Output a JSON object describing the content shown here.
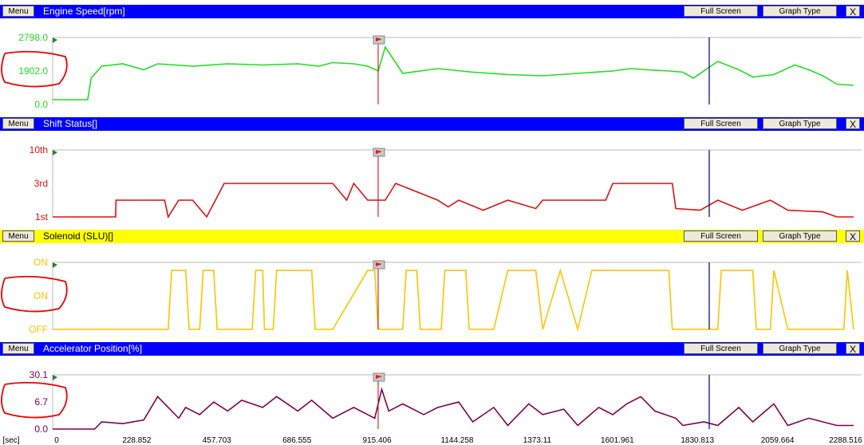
{
  "colors": {
    "header_blue": "#0000ff",
    "header_yellow": "#ffff00",
    "engine": "#22dd22",
    "shift": "#dd1111",
    "solenoid": "#ffc400",
    "accel": "#800050",
    "annotation": "#ee0000"
  },
  "ui": {
    "menu_label": "Menu",
    "full_screen_label": "Full Screen",
    "graph_type_label": "Graph Type",
    "close_label": "X"
  },
  "x_axis": {
    "unit_label": "[sec]",
    "ticks": [
      "0",
      "228.852",
      "457.703",
      "686.555",
      "915.406",
      "1144.258",
      "1373.11",
      "1601.961",
      "1830.813",
      "2059.664",
      "2288.516"
    ]
  },
  "chart_data": [
    {
      "type": "line",
      "title": "Engine Speed[rpm]",
      "ylim": [
        0,
        2798
      ],
      "y_ticks": [
        "2798.0",
        "1902.0",
        "0.0"
      ],
      "circled_tick": "1902.0",
      "x": [
        0,
        100,
        110,
        140,
        200,
        260,
        300,
        400,
        500,
        600,
        700,
        760,
        800,
        860,
        900,
        930,
        950,
        1000,
        1100,
        1200,
        1300,
        1400,
        1500,
        1600,
        1650,
        1700,
        1760,
        1800,
        1830,
        1900,
        1960,
        2000,
        2060,
        2120,
        2160,
        2200,
        2240,
        2288
      ],
      "values": [
        200,
        200,
        1100,
        1600,
        1700,
        1450,
        1700,
        1600,
        1700,
        1650,
        1700,
        1600,
        1750,
        1700,
        1600,
        1400,
        2400,
        1300,
        1500,
        1350,
        1250,
        1200,
        1300,
        1400,
        1500,
        1450,
        1400,
        1350,
        1100,
        1800,
        1450,
        1150,
        1250,
        1650,
        1450,
        1200,
        850,
        800
      ]
    },
    {
      "type": "line",
      "title": "Shift Status[]",
      "y_ticks": [
        "10th",
        "3rd",
        "1st"
      ],
      "x": [
        0,
        180,
        181,
        320,
        330,
        360,
        400,
        440,
        490,
        540,
        800,
        840,
        860,
        900,
        950,
        980,
        1100,
        1130,
        1160,
        1230,
        1300,
        1380,
        1400,
        1480,
        1580,
        1600,
        1700,
        1770,
        1780,
        1850,
        1900,
        1970,
        2050,
        2100,
        2200,
        2240,
        2288
      ],
      "values": [
        1,
        1,
        2,
        2,
        1,
        2,
        2,
        1,
        3,
        3,
        3,
        2,
        3,
        2,
        2,
        3,
        2,
        1.6,
        2,
        1.4,
        2,
        1.5,
        2,
        2,
        2,
        3,
        3,
        3,
        1.5,
        1.4,
        2,
        1.4,
        2,
        1.4,
        1.3,
        1,
        1
      ],
      "y_scale_note": "1=1st, 2=2nd, 3=3rd, 10=10th"
    },
    {
      "type": "line",
      "title": "Solenoid (SLU)[]",
      "y_ticks": [
        "ON",
        "ON",
        "OFF"
      ],
      "circled_tick": "ON",
      "x": [
        0,
        330,
        340,
        380,
        390,
        420,
        430,
        460,
        470,
        570,
        580,
        600,
        605,
        630,
        640,
        740,
        750,
        800,
        900,
        920,
        930,
        1000,
        1010,
        1040,
        1050,
        1110,
        1120,
        1180,
        1190,
        1260,
        1300,
        1380,
        1400,
        1450,
        1500,
        1540,
        1560,
        1700,
        1760,
        1770,
        1900,
        1910,
        2000,
        2010,
        2050,
        2060,
        2100,
        2260,
        2270,
        2288
      ],
      "values": [
        0,
        0,
        1,
        1,
        0,
        0,
        1,
        1,
        0,
        0,
        1,
        1,
        0,
        0,
        1,
        1,
        0,
        0,
        1,
        1,
        0,
        0,
        1,
        1,
        0,
        0,
        1,
        1,
        0,
        0,
        1,
        1,
        0,
        1,
        0,
        1,
        1,
        1,
        1,
        0,
        0,
        1,
        1,
        0,
        0,
        1,
        0,
        0,
        1,
        0
      ]
    },
    {
      "type": "line",
      "title": "Accelerator Position[%]",
      "ylim": [
        0,
        30.1
      ],
      "y_ticks": [
        "30.1",
        "6.7",
        "0.0"
      ],
      "circled_tick": "6.7",
      "x": [
        0,
        120,
        140,
        200,
        260,
        300,
        360,
        380,
        420,
        460,
        500,
        540,
        600,
        640,
        700,
        740,
        800,
        860,
        900,
        920,
        940,
        960,
        1000,
        1060,
        1100,
        1160,
        1200,
        1260,
        1300,
        1360,
        1400,
        1460,
        1500,
        1560,
        1600,
        1640,
        1680,
        1720,
        1780,
        1800,
        1860,
        1900,
        1960,
        2000,
        2060,
        2100,
        2160,
        2200,
        2240,
        2288
      ],
      "values": [
        0,
        0,
        4,
        3,
        5,
        18,
        6,
        12,
        8,
        15,
        10,
        16,
        12,
        18,
        10,
        16,
        6,
        12,
        8,
        6,
        22,
        10,
        14,
        8,
        12,
        15,
        4,
        12,
        2,
        14,
        8,
        11,
        2,
        12,
        8,
        14,
        18,
        10,
        6,
        2,
        4,
        2,
        12,
        4,
        14,
        2,
        6,
        4,
        2,
        2
      ]
    }
  ],
  "panels": [
    {
      "title": "Engine Speed[rpm]"
    },
    {
      "title": "Shift Status[]"
    },
    {
      "title": "Solenoid (SLU)[]"
    },
    {
      "title": "Accelerator Position[%]"
    }
  ]
}
